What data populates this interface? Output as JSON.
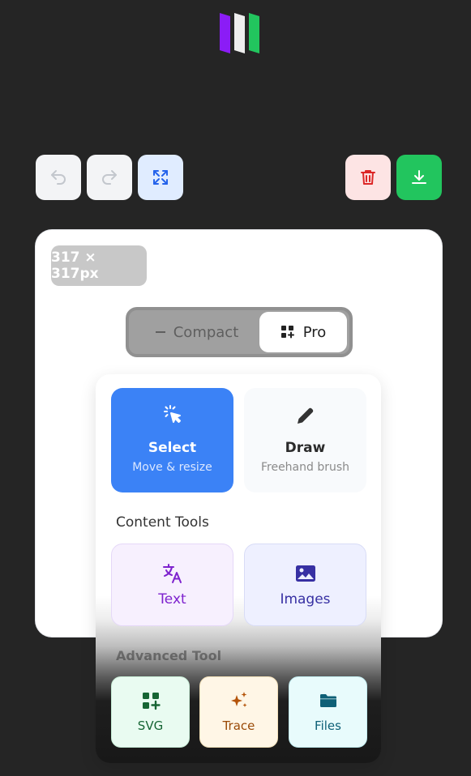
{
  "app": {
    "logo_colors": [
      "#8b1cf6",
      "#f0f0f0",
      "#22c55e"
    ]
  },
  "toolbar": {
    "undo_icon": "undo-icon",
    "redo_icon": "redo-icon",
    "fit_icon": "expand-icon",
    "delete_icon": "trash-icon",
    "download_icon": "download-icon"
  },
  "canvas": {
    "dimensions_label": "317 × 317px"
  },
  "mode": {
    "compact_label": "Compact",
    "pro_label": "Pro",
    "selected": "Pro"
  },
  "tools": {
    "select": {
      "title": "Select",
      "subtitle": "Move & resize",
      "icon": "cursor-click-icon"
    },
    "draw": {
      "title": "Draw",
      "subtitle": "Freehand brush",
      "icon": "pencil-icon"
    }
  },
  "content_tools": {
    "title": "Content Tools",
    "text": {
      "label": "Text",
      "icon": "translate-icon"
    },
    "images": {
      "label": "Images",
      "icon": "image-icon"
    }
  },
  "advanced_tools": {
    "title": "Advanced Tool",
    "svg": {
      "label": "SVG",
      "icon": "add-widget-icon"
    },
    "trace": {
      "label": "Trace",
      "icon": "sparkles-icon"
    },
    "files": {
      "label": "Files",
      "icon": "folder-icon"
    }
  },
  "colors": {
    "accent": "#3b82f6",
    "success": "#22c55e",
    "danger": "#dc2626"
  }
}
